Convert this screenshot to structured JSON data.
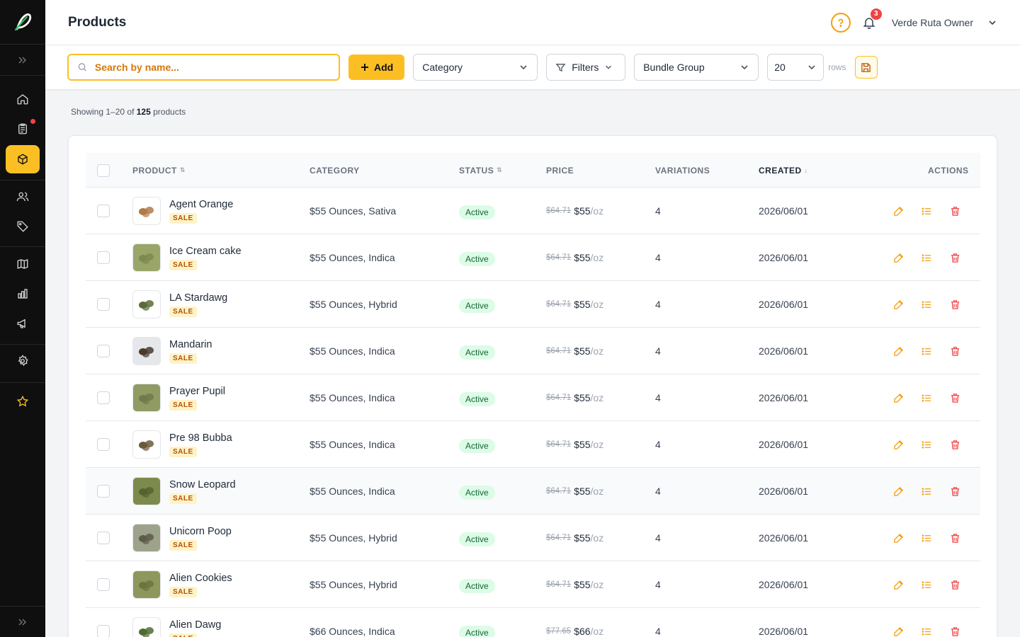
{
  "header": {
    "title": "Products",
    "user_name": "Verde Ruta Owner",
    "notifications_count": "3"
  },
  "toolbar": {
    "search_placeholder": "Search by name...",
    "add_label": "Add",
    "category_label": "Category",
    "filters_label": "Filters",
    "bundle_group_label": "Bundle Group",
    "rows_value": "20",
    "rows_label": "rows"
  },
  "summary": {
    "prefix": "Showing 1–20 of",
    "total": "125",
    "suffix": "products"
  },
  "table": {
    "columns": {
      "product": "PRODUCT",
      "category": "CATEGORY",
      "status": "STATUS",
      "price": "PRICE",
      "variations": "VARIATIONS",
      "created": "CREATED",
      "actions": "ACTIONS"
    },
    "sort_glyph": "⇅",
    "sort_desc_glyph": "↓",
    "rows": [
      {
        "name": "Agent Orange",
        "badge": "SALE",
        "category": "$55 Ounces, Sativa",
        "status": "Active",
        "old_price": "$64.71",
        "price": "$55",
        "unit": "/oz",
        "variations": "4",
        "created": "2026/06/01"
      },
      {
        "name": "Ice Cream cake",
        "badge": "SALE",
        "category": "$55 Ounces, Indica",
        "status": "Active",
        "old_price": "$64.71",
        "price": "$55",
        "unit": "/oz",
        "variations": "4",
        "created": "2026/06/01"
      },
      {
        "name": "LA Stardawg",
        "badge": "SALE",
        "category": "$55 Ounces, Hybrid",
        "status": "Active",
        "old_price": "$64.71",
        "price": "$55",
        "unit": "/oz",
        "variations": "4",
        "created": "2026/06/01"
      },
      {
        "name": "Mandarin",
        "badge": "SALE",
        "category": "$55 Ounces, Indica",
        "status": "Active",
        "old_price": "$64.71",
        "price": "$55",
        "unit": "/oz",
        "variations": "4",
        "created": "2026/06/01"
      },
      {
        "name": "Prayer Pupil",
        "badge": "SALE",
        "category": "$55 Ounces, Indica",
        "status": "Active",
        "old_price": "$64.71",
        "price": "$55",
        "unit": "/oz",
        "variations": "4",
        "created": "2026/06/01"
      },
      {
        "name": "Pre 98 Bubba",
        "badge": "SALE",
        "category": "$55 Ounces, Indica",
        "status": "Active",
        "old_price": "$64.71",
        "price": "$55",
        "unit": "/oz",
        "variations": "4",
        "created": "2026/06/01"
      },
      {
        "name": "Snow Leopard",
        "badge": "SALE",
        "category": "$55 Ounces, Indica",
        "status": "Active",
        "old_price": "$64.71",
        "price": "$55",
        "unit": "/oz",
        "variations": "4",
        "created": "2026/06/01"
      },
      {
        "name": "Unicorn Poop",
        "badge": "SALE",
        "category": "$55 Ounces, Hybrid",
        "status": "Active",
        "old_price": "$64.71",
        "price": "$55",
        "unit": "/oz",
        "variations": "4",
        "created": "2026/06/01"
      },
      {
        "name": "Alien Cookies",
        "badge": "SALE",
        "category": "$55 Ounces, Hybrid",
        "status": "Active",
        "old_price": "$64.71",
        "price": "$55",
        "unit": "/oz",
        "variations": "4",
        "created": "2026/06/01"
      },
      {
        "name": "Alien Dawg",
        "badge": "SALE",
        "category": "$66 Ounces, Indica",
        "status": "Active",
        "old_price": "$77.65",
        "price": "$66",
        "unit": "/oz",
        "variations": "4",
        "created": "2026/06/01"
      }
    ]
  },
  "colors": {
    "accent": "#fbbf24",
    "sidebar_bg": "#0f0f10",
    "status_active_bg": "#dcfce7",
    "status_active_text": "#166534",
    "sale_badge_bg": "#fef3c7",
    "delete_icon": "#ef4444"
  },
  "icons": [
    "logo-icon",
    "expand-icon",
    "home-icon",
    "orders-icon",
    "products-icon",
    "users-icon",
    "tag-icon",
    "map-icon",
    "chart-icon",
    "megaphone-icon",
    "gear-icon",
    "star-icon",
    "help-icon",
    "bell-icon",
    "chevron-down-icon",
    "search-icon",
    "plus-icon",
    "filter-icon",
    "save-icon",
    "edit-icon",
    "list-icon",
    "trash-icon"
  ]
}
